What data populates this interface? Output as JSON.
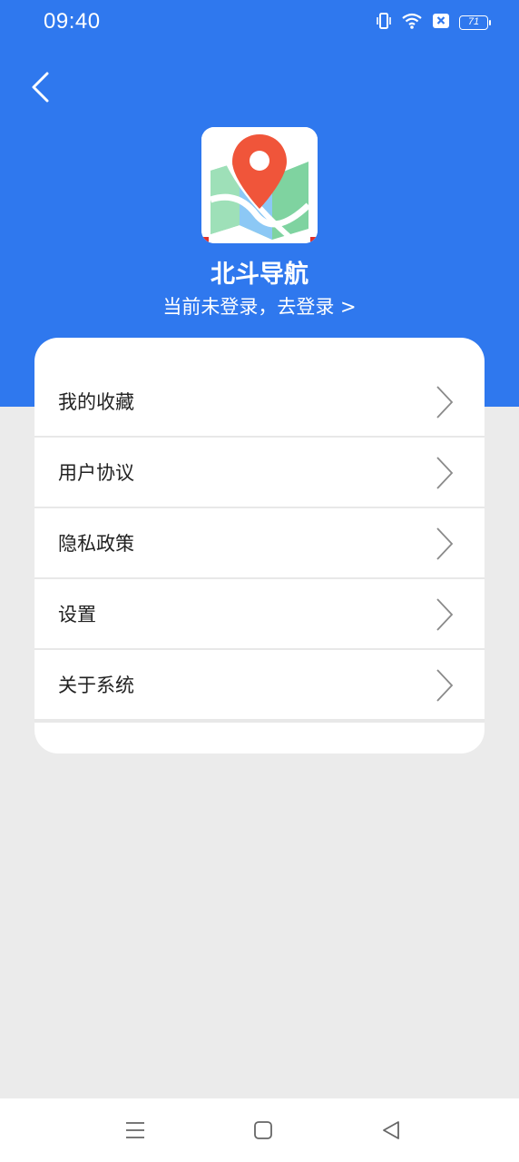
{
  "status_bar": {
    "time": "09:40",
    "battery": "71",
    "icons": [
      "vibrate-icon",
      "wifi-icon",
      "no-sim-icon",
      "battery-icon"
    ]
  },
  "header": {
    "back_icon": "chevron-left-icon",
    "app_icon": "map-pin-icon",
    "app_name": "北斗导航",
    "login_prompt": "当前未登录，去登录 >"
  },
  "menu": {
    "items": [
      {
        "label": "我的收藏",
        "icon": "chevron-right-icon"
      },
      {
        "label": "用户协议",
        "icon": "chevron-right-icon"
      },
      {
        "label": "隐私政策",
        "icon": "chevron-right-icon"
      },
      {
        "label": "设置",
        "icon": "chevron-right-icon"
      },
      {
        "label": "关于系统",
        "icon": "chevron-right-icon"
      }
    ]
  },
  "nav_bar": {
    "icons": [
      "menu-icon",
      "home-square-icon",
      "back-triangle-icon"
    ]
  },
  "colors": {
    "primary_blue": "#2f78ee",
    "page_background": "#ebebeb",
    "card_background": "#ffffff",
    "divider": "#e8e8e8",
    "pin_red": "#f0553a"
  }
}
